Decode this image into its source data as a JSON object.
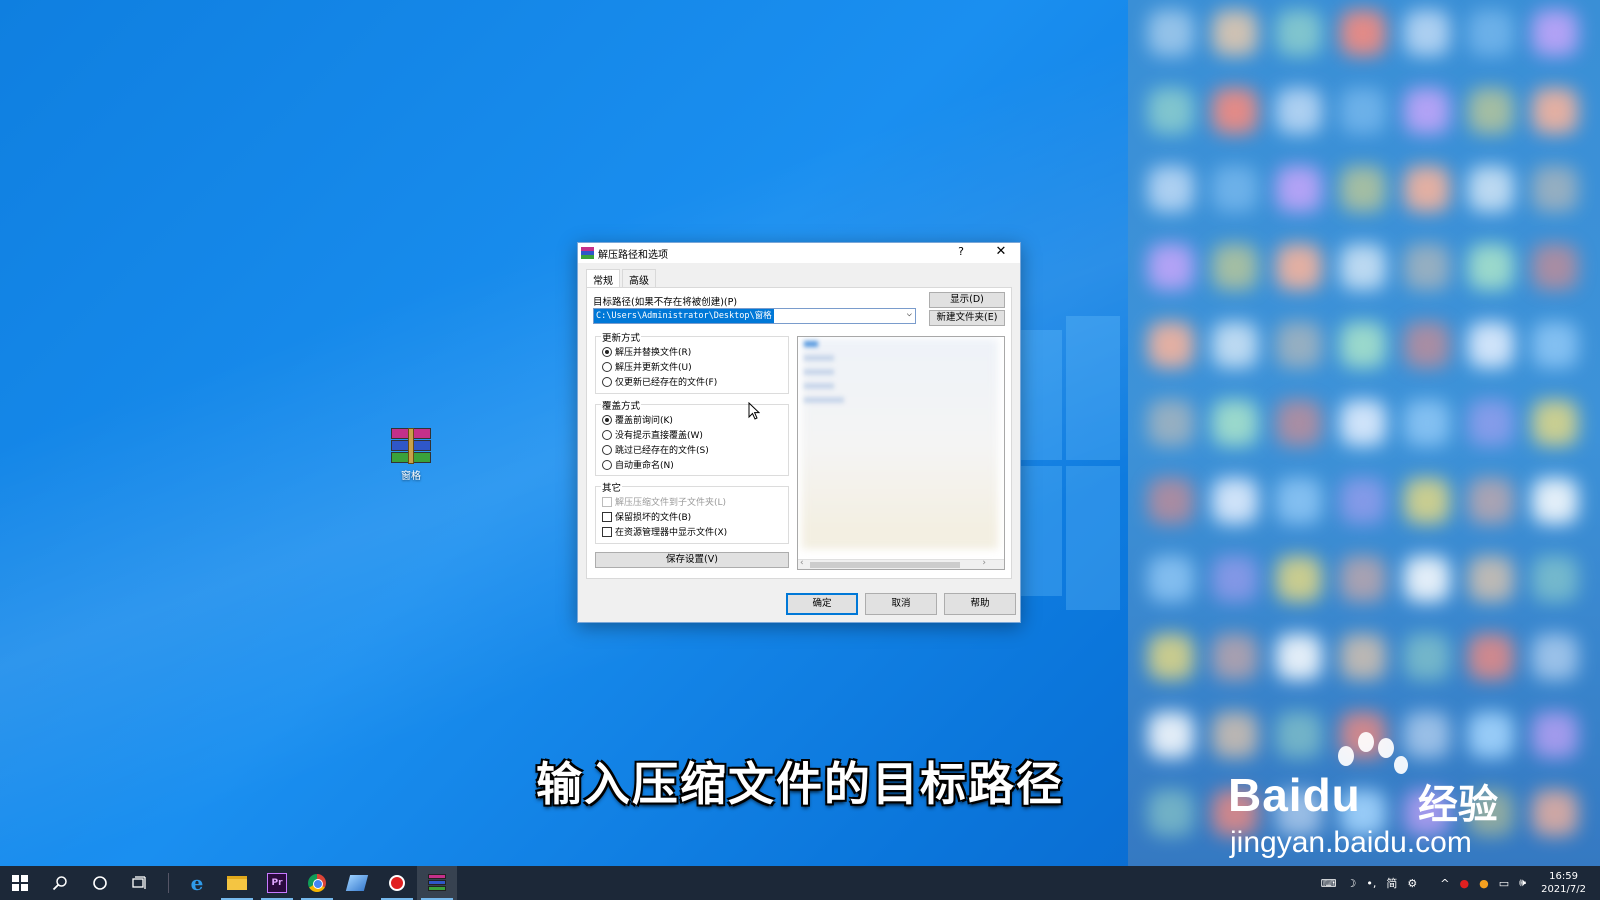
{
  "desktop": {
    "icon_label": "窗格",
    "caption": "输入压缩文件的目标路径"
  },
  "dialog": {
    "title": "解压路径和选项",
    "help_glyph": "?",
    "close_glyph": "✕",
    "tabs": [
      {
        "label": "常规",
        "active": true
      },
      {
        "label": "高级",
        "active": false
      }
    ],
    "path_label": "目标路径(如果不存在将被创建)(P)",
    "path_value": "C:\\Users\\Administrator\\Desktop\\窗格",
    "show_button": "显示(D)",
    "new_folder_button": "新建文件夹(E)",
    "update_group": {
      "title": "更新方式",
      "options": [
        {
          "label": "解压并替换文件(R)",
          "checked": true
        },
        {
          "label": "解压并更新文件(U)",
          "checked": false
        },
        {
          "label": "仅更新已经存在的文件(F)",
          "checked": false
        }
      ]
    },
    "overwrite_group": {
      "title": "覆盖方式",
      "options": [
        {
          "label": "覆盖前询问(K)",
          "checked": true
        },
        {
          "label": "没有提示直接覆盖(W)",
          "checked": false
        },
        {
          "label": "跳过已经存在的文件(S)",
          "checked": false
        },
        {
          "label": "自动重命名(N)",
          "checked": false
        }
      ]
    },
    "other_group": {
      "title": "其它",
      "options": [
        {
          "label": "解压压缩文件到子文件夹(L)",
          "checked": false,
          "disabled": true
        },
        {
          "label": "保留损坏的文件(B)",
          "checked": false,
          "disabled": false
        },
        {
          "label": "在资源管理器中显示文件(X)",
          "checked": false,
          "disabled": false
        }
      ]
    },
    "save_button": "保存设置(V)",
    "ok_button": "确定",
    "cancel_button": "取消",
    "help_button": "帮助"
  },
  "watermark": {
    "brand": "Baidu",
    "brand_cn": "经验",
    "url": "jingyan.baidu.com"
  },
  "taskbar": {
    "tray_lang": "简",
    "clock_time": "16:59",
    "clock_date": "2021/7/2"
  },
  "colors": {
    "desktop_blue": "#1a8ff0",
    "selection_blue": "#0078d7",
    "taskbar": "#1c2838"
  }
}
